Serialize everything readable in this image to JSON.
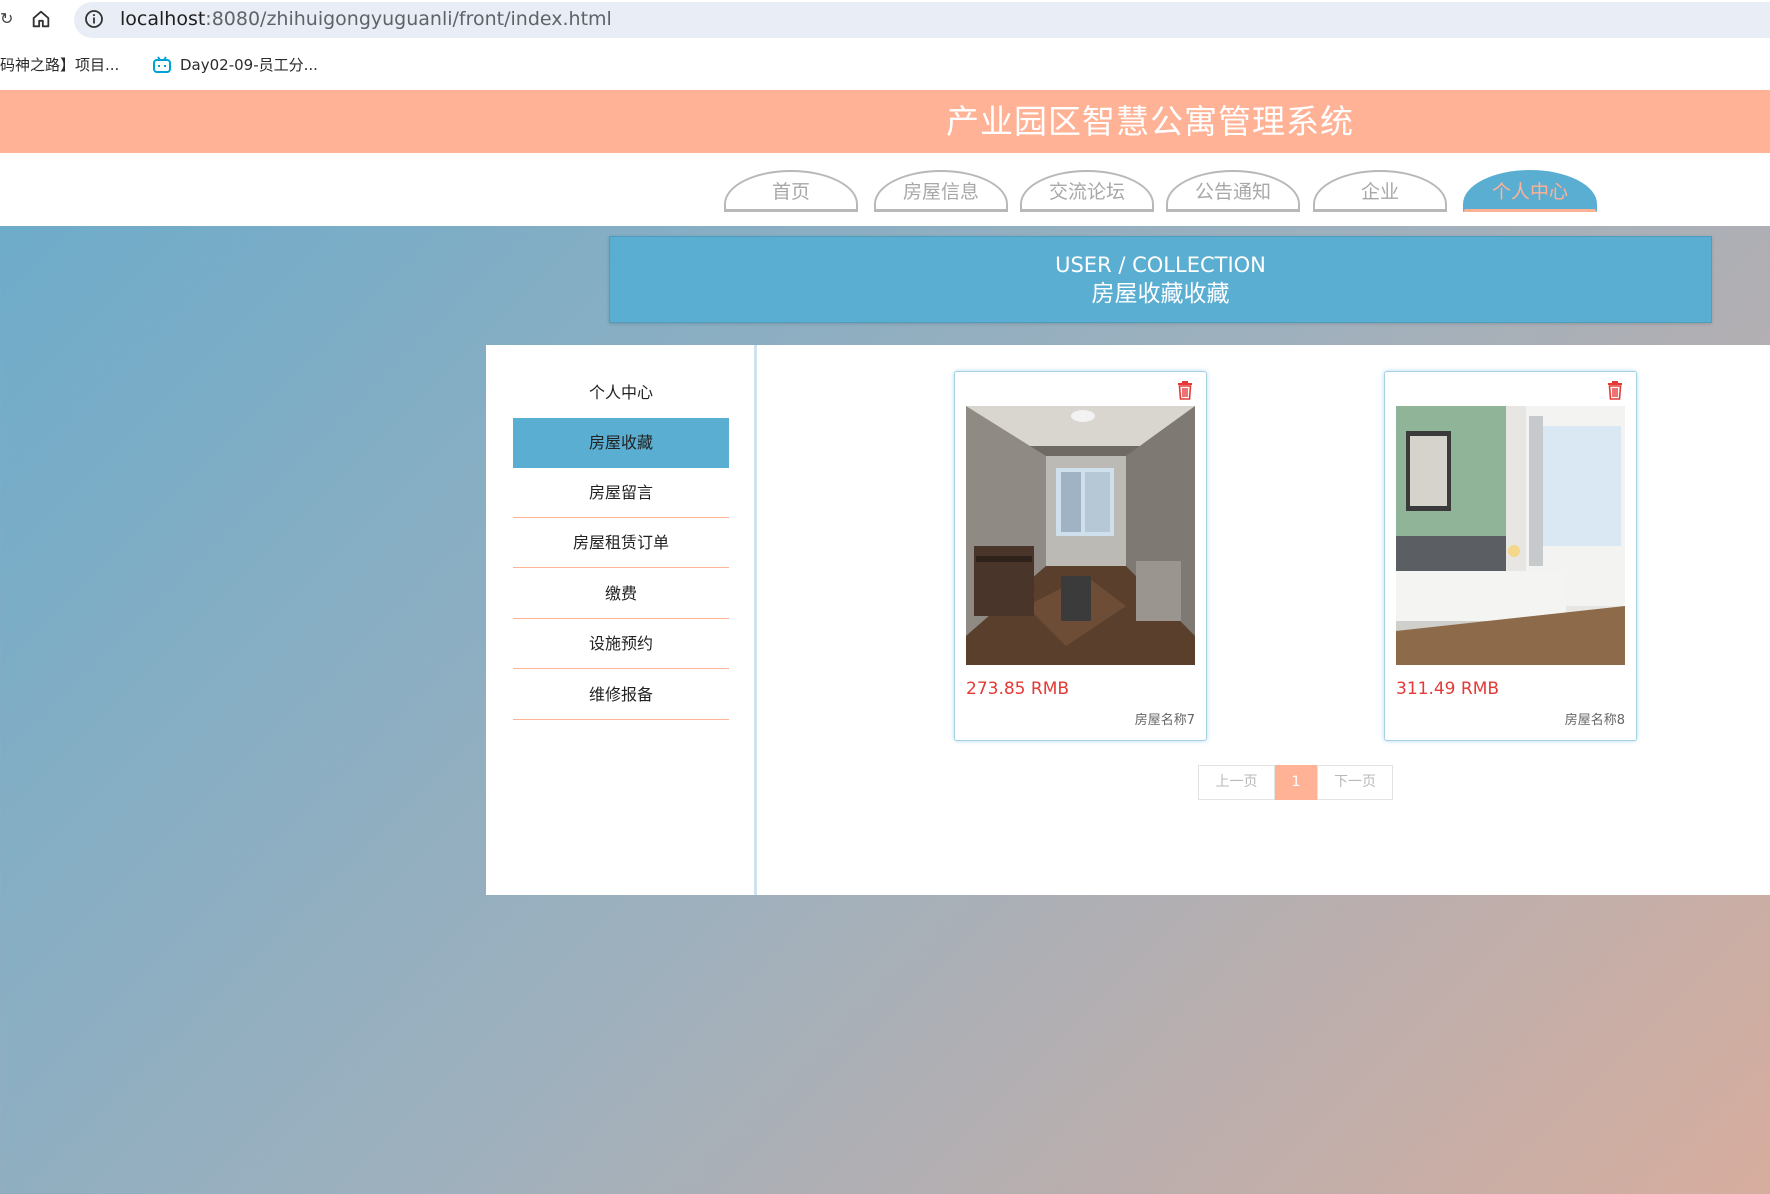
{
  "browser": {
    "url_host": "localhost",
    "url_path": ":8080/zhihuigongyuguanli/front/index.html",
    "bookmarks": [
      "码神之路】项目...",
      "Day02-09-员工分..."
    ]
  },
  "site": {
    "title": "产业园区智慧公寓管理系统",
    "nav": [
      {
        "label": "首页"
      },
      {
        "label": "房屋信息"
      },
      {
        "label": "交流论坛"
      },
      {
        "label": "公告通知"
      },
      {
        "label": "企业"
      },
      {
        "label": "个人中心"
      }
    ]
  },
  "banner": {
    "en": "USER / COLLECTION",
    "cn": "房屋收藏收藏"
  },
  "sidebar": {
    "items": [
      {
        "label": "个人中心"
      },
      {
        "label": "房屋收藏"
      },
      {
        "label": "房屋留言"
      },
      {
        "label": "房屋租赁订单"
      },
      {
        "label": "缴费"
      },
      {
        "label": "设施预约"
      },
      {
        "label": "维修报备"
      }
    ]
  },
  "cards": [
    {
      "price": "273.85 RMB",
      "name": "房屋名称7"
    },
    {
      "price": "311.49 RMB",
      "name": "房屋名称8"
    }
  ],
  "pagination": {
    "prev": "上一页",
    "current": "1",
    "next": "下一页"
  },
  "colors": {
    "header": "#ffb295",
    "accent": "#5aaed1",
    "price": "#e53935"
  }
}
